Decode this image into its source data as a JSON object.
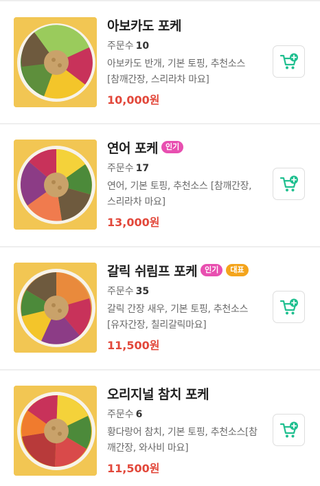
{
  "menu": {
    "items": [
      {
        "name": "아보카도 포케",
        "orders_label": "주문수",
        "orders_count": "10",
        "description": "아보카도 반개, 기본 토핑, 추천소스 [참깨간장, 스리라차 마요]",
        "price": "10,000원",
        "badges": []
      },
      {
        "name": "연어 포케",
        "orders_label": "주문수",
        "orders_count": "17",
        "description": "연어, 기본 토핑, 추천소스 [참깨간장, 스리라차 마요]",
        "price": "13,000원",
        "badges": [
          "인기"
        ]
      },
      {
        "name": "갈릭 쉬림프 포케",
        "orders_label": "주문수",
        "orders_count": "35",
        "description": "갈릭 간장 새우, 기본 토핑, 추천소스 [유자간장, 칠리갈릭마요]",
        "price": "11,500원",
        "badges": [
          "인기",
          "대표"
        ]
      },
      {
        "name": "오리지널 참치 포케",
        "orders_label": "주문수",
        "orders_count": "6",
        "description": "황다랑어 참치, 기본 토핑, 추천소스[참깨간장, 와사비 마요]",
        "price": "11,500원",
        "badges": []
      }
    ]
  },
  "colors": {
    "price": "#e2473a",
    "badge_popular": "#e84fb0",
    "badge_signature": "#f4a41c",
    "cart_icon": "#1fbf8f",
    "thumb_background": "#f2c653"
  },
  "icons": {
    "cart": "cart-plus-icon"
  }
}
